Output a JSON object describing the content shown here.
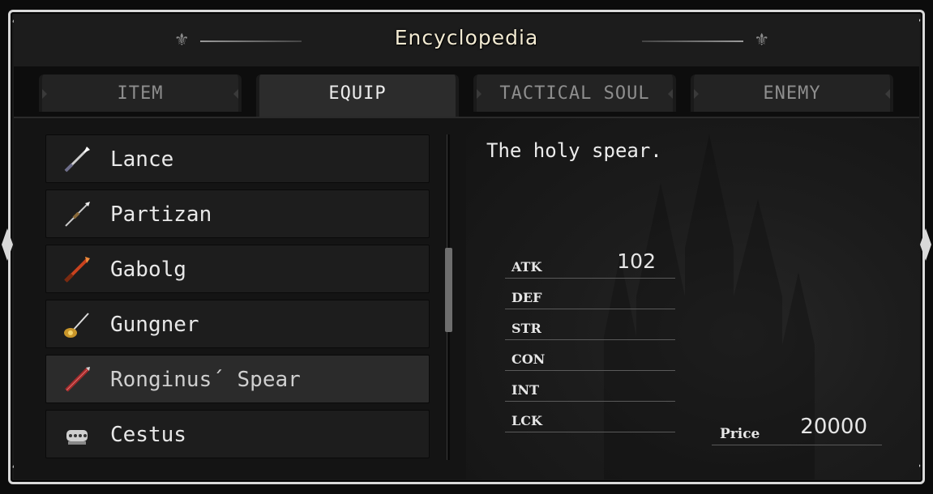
{
  "window": {
    "title": "Encyclopedia"
  },
  "tabs": [
    {
      "label": "ITEM",
      "active": false
    },
    {
      "label": "EQUIP",
      "active": true
    },
    {
      "label": "TACTICAL SOUL",
      "active": false
    },
    {
      "label": "ENEMY",
      "active": false
    }
  ],
  "list": {
    "items": [
      {
        "name": "Lance",
        "icon": "lance-icon",
        "selected": false
      },
      {
        "name": "Partizan",
        "icon": "partizan-icon",
        "selected": false
      },
      {
        "name": "Gabolg",
        "icon": "gabolg-icon",
        "selected": false
      },
      {
        "name": "Gungner",
        "icon": "gungner-icon",
        "selected": false
      },
      {
        "name": "Ronginus´ Spear",
        "icon": "ronginus-spear-icon",
        "selected": true
      },
      {
        "name": "Cestus",
        "icon": "cestus-icon",
        "selected": false
      }
    ]
  },
  "detail": {
    "description": "The holy spear.",
    "stats": [
      {
        "label": "ATK",
        "value": "102"
      },
      {
        "label": "DEF",
        "value": ""
      },
      {
        "label": "STR",
        "value": ""
      },
      {
        "label": "CON",
        "value": ""
      },
      {
        "label": "INT",
        "value": ""
      },
      {
        "label": "LCK",
        "value": ""
      }
    ],
    "price_label": "Price",
    "price_value": "20000"
  },
  "colors": {
    "frame": "#d9d9d9",
    "title": "#f2ead2",
    "panel": "#1d1d1d",
    "selected": "#2b2b2b"
  }
}
